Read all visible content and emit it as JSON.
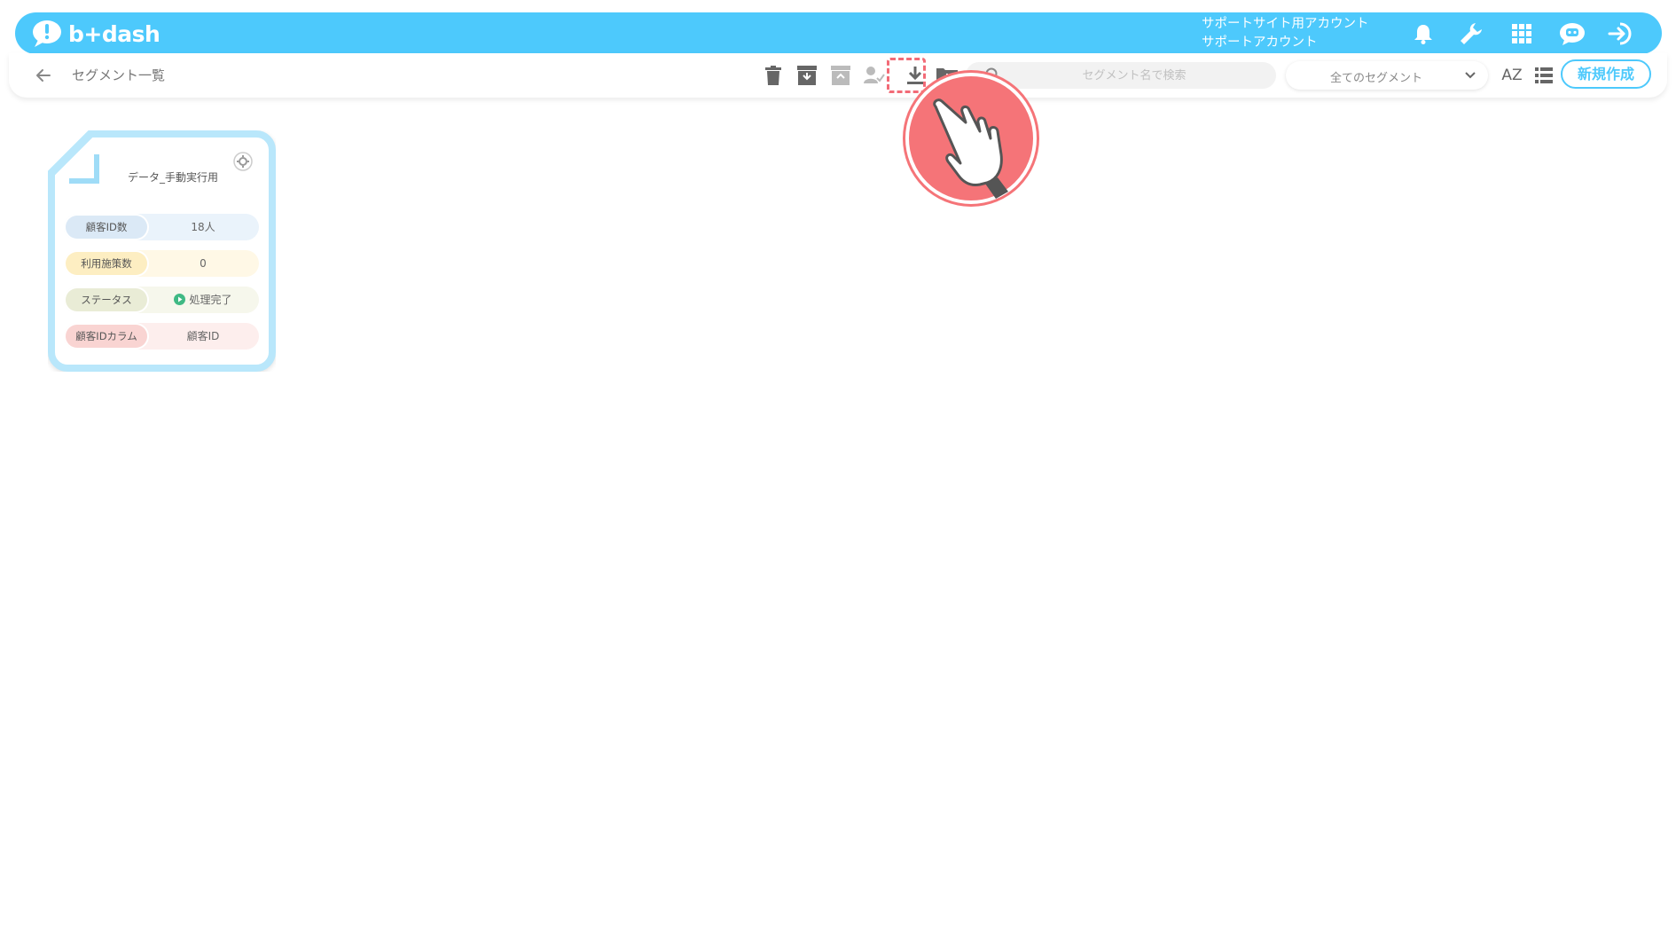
{
  "header": {
    "logo_text": "b+dash",
    "account_line1": "サポートサイト用アカウント",
    "account_line2": "サポートアカウント",
    "icons": [
      "bell-icon",
      "wrench-icon",
      "grid-icon",
      "chat-robot-icon",
      "logout-icon"
    ]
  },
  "toolbar": {
    "page_title": "セグメント一覧",
    "search_placeholder": "セグメント名で検索",
    "segment_filter_value": "全てのセグメント",
    "sort_label": "AZ",
    "new_button_label": "新規作成",
    "icons": [
      "trash-icon",
      "archive-icon",
      "unarchive-icon",
      "user-check-icon",
      "download-icon",
      "folder-add-icon",
      "search-icon",
      "list-view-icon"
    ]
  },
  "card": {
    "name": "データ_手動実行用",
    "rows": [
      {
        "label": "顧客ID数",
        "value": "18人"
      },
      {
        "label": "利用施策数",
        "value": "0"
      },
      {
        "label": "ステータス",
        "value": "処理完了"
      },
      {
        "label": "顧客IDカラム",
        "value": "顧客ID"
      }
    ]
  },
  "colors": {
    "brand": "#4dc9fc",
    "highlight": "#f26b77",
    "status_ok": "#3fb984"
  }
}
